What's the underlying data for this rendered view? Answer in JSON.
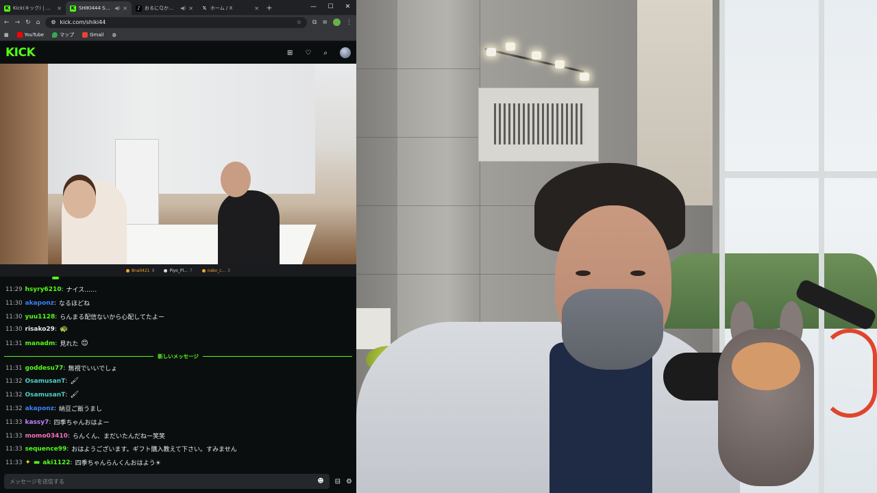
{
  "browser": {
    "tabs": [
      {
        "title": "Kick(キック) | リアルタイ",
        "favicon": "kick-tab-icon",
        "active": false
      },
      {
        "title": "SHIKI444 Stream",
        "favicon": "kick-tab-icon",
        "active": true,
        "audio": true
      },
      {
        "title": "おるにＱかわいい",
        "favicon": "tiktok-tab-icon",
        "active": false,
        "audio": true
      },
      {
        "title": "ホーム / X",
        "favicon": "x-tab-icon",
        "active": false
      }
    ],
    "url": "kick.com/shiki44",
    "bookmarks": [
      {
        "label": "YouTube",
        "icon": "youtube-icon"
      },
      {
        "label": "マップ",
        "icon": "maps-icon"
      },
      {
        "label": "Gmail",
        "icon": "gmail-icon"
      }
    ]
  },
  "kick": {
    "logo": "KICK",
    "accent": "#53fc18"
  },
  "gifters": [
    {
      "name": "8na0421",
      "count": "9",
      "color": "#f5a623"
    },
    {
      "name": "Piyo_Pl...",
      "count": "7",
      "color": "#d7d9dc"
    },
    {
      "name": "nako_c...",
      "count": "3",
      "color": "#f5a623"
    }
  ],
  "chat": {
    "messages": [
      {
        "time": "11:29",
        "user": "hsyry6210",
        "color": "#53fc18",
        "text": "ナイス……"
      },
      {
        "time": "11:30",
        "user": "akaponz",
        "color": "#3b82f6",
        "text": "なるほどね"
      },
      {
        "time": "11:30",
        "user": "yuu1128",
        "color": "#53fc18",
        "text": "らんまる配信ないから心配してたよー"
      },
      {
        "time": "11:30",
        "user": "risako29",
        "color": "#e8eaed",
        "text": "",
        "emote": "🐢"
      },
      {
        "time": "11:31",
        "user": "manadm",
        "color": "#53fc18",
        "text": "見れた",
        "emote": "😊"
      },
      {
        "time": "11:31",
        "user": "goddesu77",
        "color": "#53fc18",
        "text": "無視でいいでしょ"
      },
      {
        "time": "11:32",
        "user": "OsamusanT",
        "color": "#4fd1c5",
        "text": "",
        "emote": "🖌"
      },
      {
        "time": "11:32",
        "user": "OsamusanT",
        "color": "#4fd1c5",
        "text": "",
        "emote": "🖌"
      },
      {
        "time": "11:32",
        "user": "akaponz",
        "color": "#3b82f6",
        "text": "納豆ご飯うまし"
      },
      {
        "time": "11:33",
        "user": "kassy7",
        "color": "#c084fc",
        "text": "四季ちゃんおはよー"
      },
      {
        "time": "11:33",
        "user": "momo03410",
        "color": "#f472b6",
        "text": "らんくん、まだいたんだねー笑笑"
      },
      {
        "time": "11:33",
        "user": "sequence99",
        "color": "#53fc18",
        "text": "おはようございます。ギフト購入教えて下さい。すみません"
      },
      {
        "time": "11:33",
        "user": "aki1122",
        "color": "#53fc18",
        "text": "四季ちゃんらんくんおはよう☀",
        "badges": [
          "✦",
          "▬"
        ]
      }
    ],
    "new_messages_label": "新しいメッセージ",
    "input_placeholder": "メッセージを送信する"
  }
}
